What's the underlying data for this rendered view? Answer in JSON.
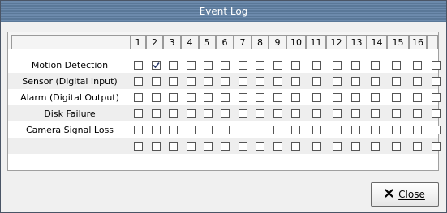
{
  "window": {
    "title": "Event Log"
  },
  "columns": [
    "1",
    "2",
    "3",
    "4",
    "5",
    "6",
    "7",
    "8",
    "9",
    "10",
    "11",
    "12",
    "13",
    "14",
    "15",
    "16"
  ],
  "rows": [
    {
      "label": "Motion Detection",
      "checked": [
        2
      ]
    },
    {
      "label": "Sensor (Digital Input)",
      "checked": []
    },
    {
      "label": "Alarm (Digital Output)",
      "checked": []
    },
    {
      "label": "Disk Failure",
      "checked": []
    },
    {
      "label": "Camera Signal Loss",
      "checked": []
    },
    {
      "label": "",
      "checked": []
    }
  ],
  "buttons": {
    "close_label": "Close",
    "close_icon": "close-icon"
  }
}
